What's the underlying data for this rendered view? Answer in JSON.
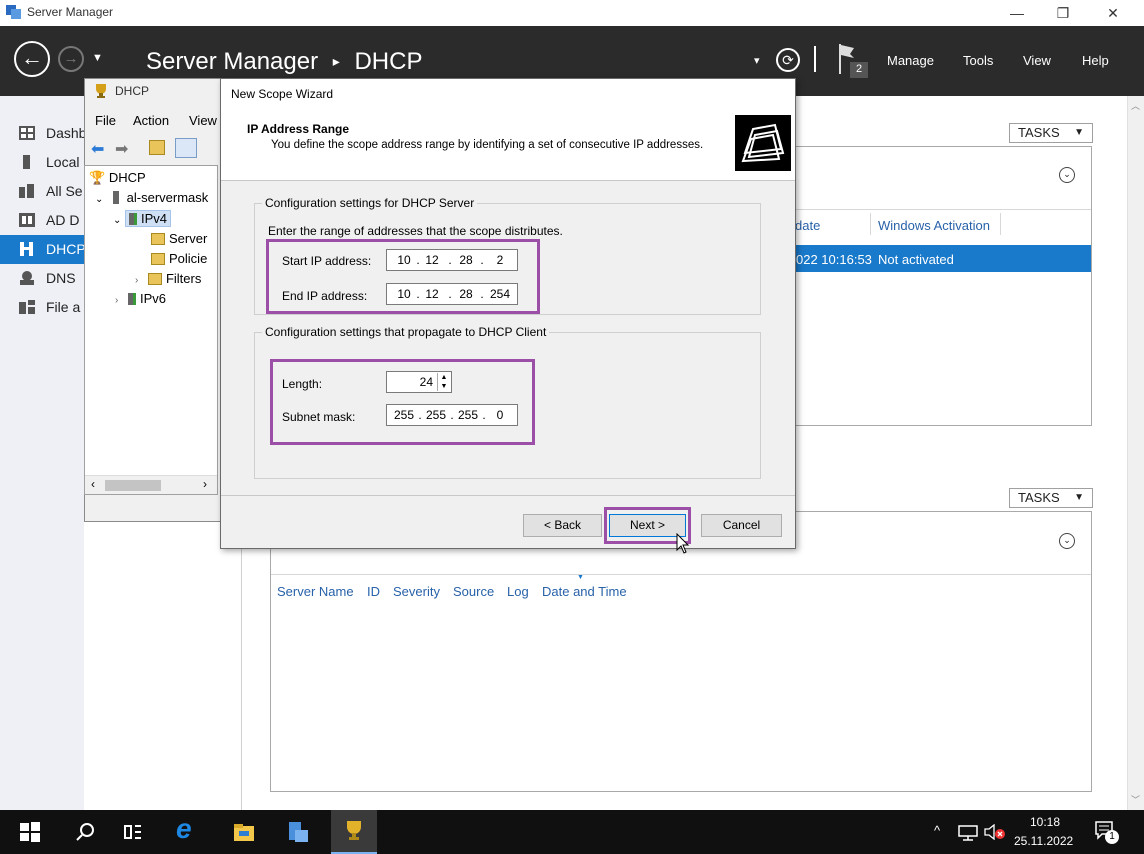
{
  "window": {
    "title": "Server Manager",
    "controls": [
      "minimize-icon",
      "restore-icon",
      "close-icon"
    ]
  },
  "header": {
    "breadcrumb_root": "Server Manager",
    "breadcrumb_sep": "▸",
    "breadcrumb_current": "DHCP",
    "notification_count": "2",
    "menu": [
      "Manage",
      "Tools",
      "View",
      "Help"
    ]
  },
  "leftnav": {
    "items": [
      {
        "label": "Dashb",
        "icon": "dashboard-icon"
      },
      {
        "label": "Local",
        "icon": "server-icon"
      },
      {
        "label": "All Se",
        "icon": "servers-icon"
      },
      {
        "label": "AD D",
        "icon": "ad-icon"
      },
      {
        "label": "DHCP",
        "icon": "dhcp-icon"
      },
      {
        "label": "DNS",
        "icon": "dns-icon"
      },
      {
        "label": "File a",
        "icon": "file-services-icon"
      }
    ],
    "active_index": 4
  },
  "main": {
    "tasks_label": "TASKS",
    "servers_table": {
      "columns": [
        "date",
        "Windows Activation"
      ],
      "rows": [
        [
          "022 10:16:53",
          "Not activated"
        ]
      ]
    },
    "events_table": {
      "columns": [
        "Server Name",
        "ID",
        "Severity",
        "Source",
        "Log",
        "Date and Time"
      ]
    }
  },
  "dhcp_console": {
    "title": "DHCP",
    "menu": [
      "File",
      "Action",
      "View"
    ],
    "tree": {
      "root": "DHCP",
      "server": "al-servermask",
      "ipv4": "IPv4",
      "ipv4_children": [
        "Server",
        "Policie",
        "Filters"
      ],
      "ipv6": "IPv6"
    }
  },
  "wizard": {
    "title": "New Scope Wizard",
    "heading": "IP Address Range",
    "subheading": "You define the scope address range by identifying a set of consecutive IP addresses.",
    "server_group": {
      "label": "Configuration settings for DHCP Server",
      "description": "Enter the range of addresses that the scope distributes.",
      "start_label": "Start IP address:",
      "start_octets": [
        "10",
        "12",
        "28",
        "2"
      ],
      "end_label": "End IP address:",
      "end_octets": [
        "10",
        "12",
        "28",
        "254"
      ]
    },
    "client_group": {
      "label": "Configuration settings that propagate to DHCP Client",
      "length_label": "Length:",
      "length_value": "24",
      "mask_label": "Subnet mask:",
      "mask_octets": [
        "255",
        "255",
        "255",
        "0"
      ]
    },
    "buttons": {
      "back": "< Back",
      "next": "Next >",
      "cancel": "Cancel"
    },
    "highlight_color": "#9b4fa6"
  },
  "taskbar": {
    "time": "10:18",
    "date": "25.11.2022",
    "notification_badge": "1"
  }
}
